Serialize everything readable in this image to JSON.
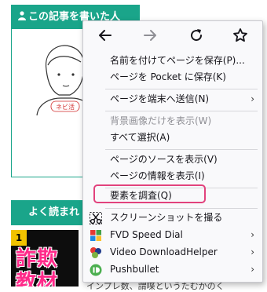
{
  "author_box": {
    "header": "この記事を書いた人",
    "avatar_tag": "ネビ活"
  },
  "popular": {
    "header": "よく読まれ",
    "rank": "1",
    "thumb_line1": "詐欺",
    "thumb_line2": "教材"
  },
  "snippet": "インプレ数、謂喋というたむかのく",
  "menu": {
    "nav": [
      "back-arrow-icon",
      "forward-arrow-icon",
      "reload-icon",
      "bookmark-star-icon"
    ],
    "items": {
      "save_page": "名前を付けてページを保存(P)...",
      "save_pocket": "ページを Pocket に保存(K)",
      "send_device": "ページを端末へ送信(N)",
      "bg_image": "背景画像だけを表示(W)",
      "select_all": "すべて選択(A)",
      "view_source": "ページのソースを表示(V)",
      "page_info": "ページの情報を表示(I)",
      "inspect": "要素を調査(Q)",
      "screenshot": "スクリーンショットを撮る",
      "fvd": "FVD Speed Dial",
      "video_dl": "Video DownloadHelper",
      "pushbullet": "Pushbullet"
    },
    "submenu_arrow": "›"
  },
  "colors": {
    "accent": "#1aa58a",
    "highlight": "#e2427d",
    "menu_bg": "#f9f9fb",
    "disabled_text": "#8f8f95"
  }
}
